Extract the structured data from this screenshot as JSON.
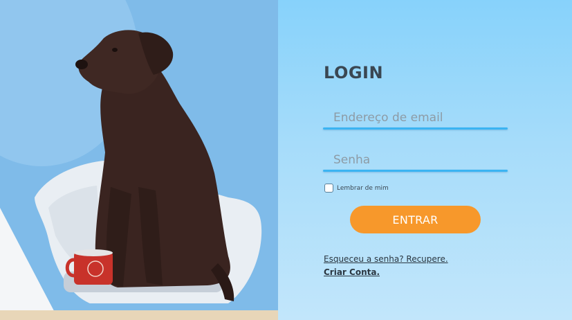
{
  "photo": {
    "description_icon": "dog-photo"
  },
  "login": {
    "title": "LOGIN",
    "email": {
      "placeholder": "Endereço de email",
      "value": ""
    },
    "password": {
      "placeholder": "Senha",
      "value": ""
    },
    "remember_label": "Lembrar de mim",
    "submit_label": "ENTRAR",
    "forgot_link": "Esqueceu a senha? Recupere.",
    "create_link": "Criar Conta."
  },
  "colors": {
    "accent": "#3bb4f2",
    "button": "#f7982b",
    "title": "#3a4752"
  }
}
